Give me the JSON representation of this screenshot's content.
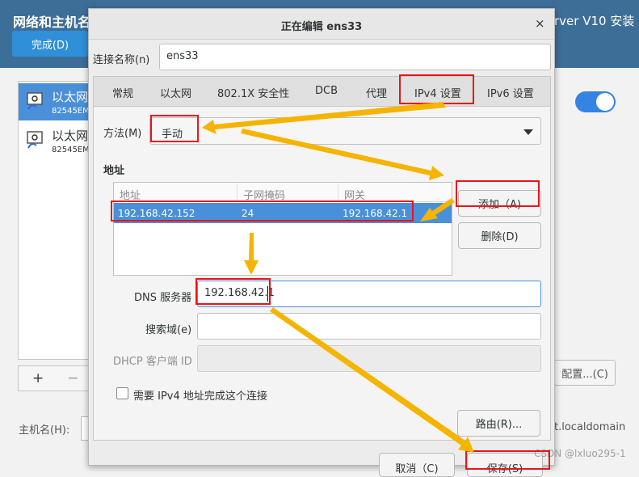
{
  "background": {
    "title_left": "网络和主机名",
    "title_right": "rver V10 安装",
    "done_button": "完成(D)",
    "connections": [
      {
        "name": "以太网",
        "device": "82545EM"
      },
      {
        "name": "以太网",
        "device": "82545EM"
      }
    ],
    "add_symbol": "+",
    "remove_symbol": "−",
    "configure_button": "配置...(C)",
    "hostname_label": "主机名(H):",
    "localdomain_text": "t.localdomain",
    "watermark": "CSDN @lxluo295-1",
    "accent_color": "#3d6e98"
  },
  "dialog": {
    "title": "正在编辑 ens33",
    "close_symbol": "×",
    "connection_name_label": "连接名称(n)",
    "connection_name_value": "ens33",
    "tabs": [
      "常规",
      "以太网",
      "802.1X 安全性",
      "DCB",
      "代理",
      "IPv4 设置",
      "IPv6 设置"
    ],
    "active_tab": "IPv4 设置",
    "method_label": "方法(M)",
    "method_value": "手动",
    "address_section_label": "地址",
    "address_columns": [
      "地址",
      "子网掩码",
      "网关"
    ],
    "address_rows": [
      {
        "address": "192.168.42.152",
        "netmask": "24",
        "gateway": "192.168.42.1"
      }
    ],
    "add_button": "添加（A)",
    "delete_button": "删除(D)",
    "dns_label": "DNS 服务器",
    "dns_value": "192.168.42.1",
    "search_domain_label": "搜索域(e)",
    "search_domain_value": "",
    "dhcp_client_id_label": "DHCP 客户端 ID",
    "dhcp_client_id_value": "",
    "require_ipv4_label": "需要 IPv4 地址完成这个连接",
    "routes_button": "路由(R)...",
    "cancel_button": "取消（C)",
    "save_button": "保存(S)",
    "selection_color": "#4a90d9"
  },
  "annotations": {
    "highlight_color": "#e8141b",
    "arrow_color": "#f5b400"
  }
}
